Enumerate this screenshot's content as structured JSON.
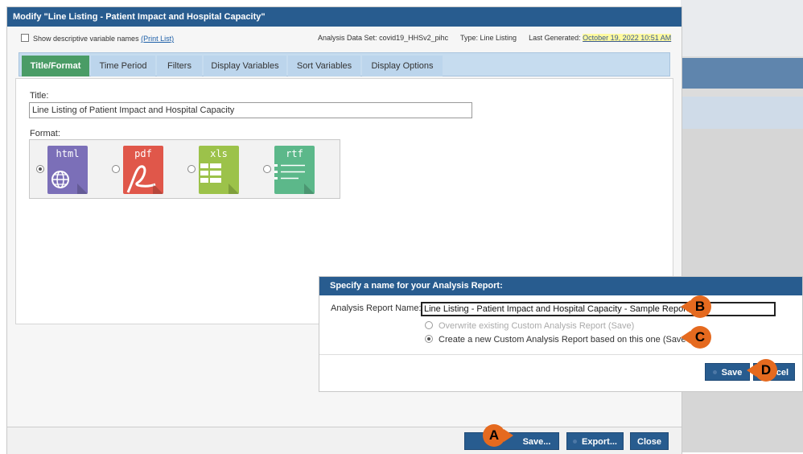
{
  "window": {
    "title": "Modify \"Line Listing - Patient Impact and Hospital Capacity\"",
    "show_descriptive_label": "Show descriptive variable names",
    "print_list_link": "(Print List)",
    "dataset_label": "Analysis Data Set:",
    "dataset_value": "covid19_HHSv2_pihc",
    "type_label": "Type:",
    "type_value": "Line Listing",
    "last_generated_label": "Last Generated:",
    "last_generated_value": "October 19, 2022 10:51 AM"
  },
  "tabs": [
    {
      "label": "Title/Format",
      "active": true
    },
    {
      "label": "Time Period",
      "active": false
    },
    {
      "label": "Filters",
      "active": false
    },
    {
      "label": "Display Variables",
      "active": false
    },
    {
      "label": "Sort Variables",
      "active": false
    },
    {
      "label": "Display Options",
      "active": false
    }
  ],
  "content": {
    "title_label": "Title:",
    "title_value": "Line Listing of Patient Impact and Hospital Capacity",
    "format_label": "Format:",
    "formats": [
      {
        "ext": "html",
        "selected": true,
        "color": "#7b6fb8",
        "icon": "globe-icon"
      },
      {
        "ext": "pdf",
        "selected": false,
        "color": "#e0574a",
        "icon": "pdf-icon"
      },
      {
        "ext": "xls",
        "selected": false,
        "color": "#9cc24a",
        "icon": "spreadsheet-icon"
      },
      {
        "ext": "rtf",
        "selected": false,
        "color": "#5cb88a",
        "icon": "document-lines-icon"
      }
    ]
  },
  "footer": {
    "save_label": "Save...",
    "export_label": "Export...",
    "close_label": "Close"
  },
  "dialog": {
    "title": "Specify a name for your Analysis Report:",
    "name_label": "Analysis Report Name:",
    "name_value": "Line Listing - Patient Impact and Hospital Capacity - Sample Report",
    "overwrite_label": "Overwrite existing Custom Analysis Report (Save)",
    "create_new_label": "Create a new Custom Analysis Report based on this one (Save as)",
    "save_label": "Save",
    "cancel_label": "Cancel"
  },
  "callouts": {
    "a": "A",
    "b": "B",
    "c": "C",
    "d": "D"
  },
  "colors": {
    "header": "#285c8f",
    "active_tab": "#4a9c66",
    "callout": "#e56a1f",
    "highlight": "#fffaa0"
  }
}
